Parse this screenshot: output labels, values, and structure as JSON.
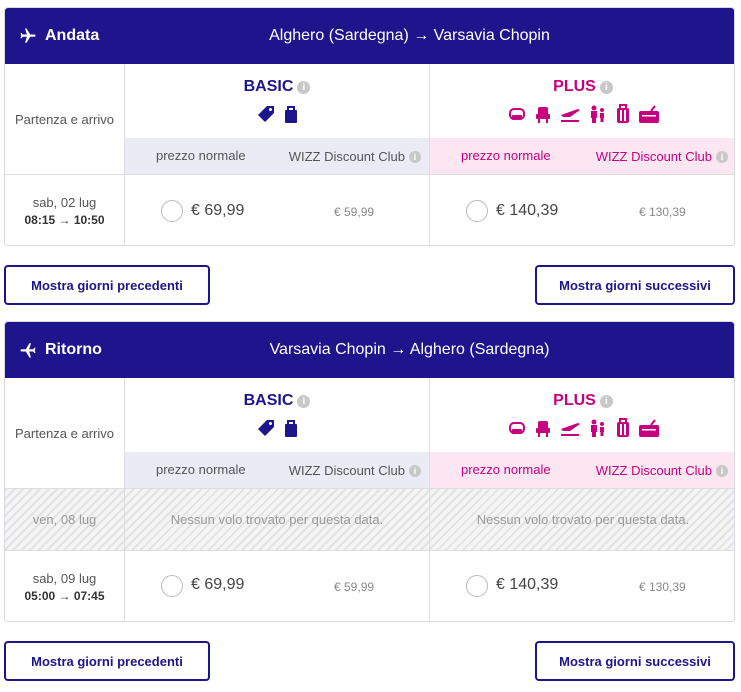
{
  "outbound": {
    "direction": "Andata",
    "route": "Alghero (Sardegna) → Varsavia Chopin",
    "label_header": "Partenza e arrivo",
    "basic": {
      "name": "BASIC",
      "normal_label": "prezzo normale",
      "club_label": "WIZZ Discount Club"
    },
    "plus": {
      "name": "PLUS",
      "normal_label": "prezzo normale",
      "club_label": "WIZZ Discount Club"
    },
    "rows": [
      {
        "date": "sab, 02 lug",
        "times": "08:15 → 10:50",
        "basic_price": "€ 69,99",
        "basic_club": "€ 59,99",
        "plus_price": "€ 140,39",
        "plus_club": "€ 130,39"
      }
    ],
    "prev_button": "Mostra giorni precedenti",
    "next_button": "Mostra giorni successivi"
  },
  "return": {
    "direction": "Ritorno",
    "route": "Varsavia Chopin → Alghero (Sardegna)",
    "label_header": "Partenza e arrivo",
    "basic": {
      "name": "BASIC",
      "normal_label": "prezzo normale",
      "club_label": "WIZZ Discount Club"
    },
    "plus": {
      "name": "PLUS",
      "normal_label": "prezzo normale",
      "club_label": "WIZZ Discount Club"
    },
    "noflight": {
      "date": "ven, 08 lug",
      "message_basic": "Nessun volo trovato per questa data.",
      "message_plus": "Nessun volo trovato per questa data."
    },
    "rows": [
      {
        "date": "sab, 09 lug",
        "times": "05:00 → 07:45",
        "basic_price": "€ 69,99",
        "basic_club": "€ 59,99",
        "plus_price": "€ 140,39",
        "plus_club": "€ 130,39"
      }
    ],
    "prev_button": "Mostra giorni precedenti",
    "next_button": "Mostra giorni successivi"
  },
  "info_glyph": "i",
  "colors": {
    "brand": "#1e148c",
    "plus": "#c6007e"
  },
  "basic_icons": [
    "tag-icon",
    "small-bag-icon"
  ],
  "plus_icons": [
    "seat-icon",
    "seat-selection-icon",
    "flight-change-icon",
    "family-icon",
    "trolley-icon",
    "checked-bag-icon"
  ]
}
